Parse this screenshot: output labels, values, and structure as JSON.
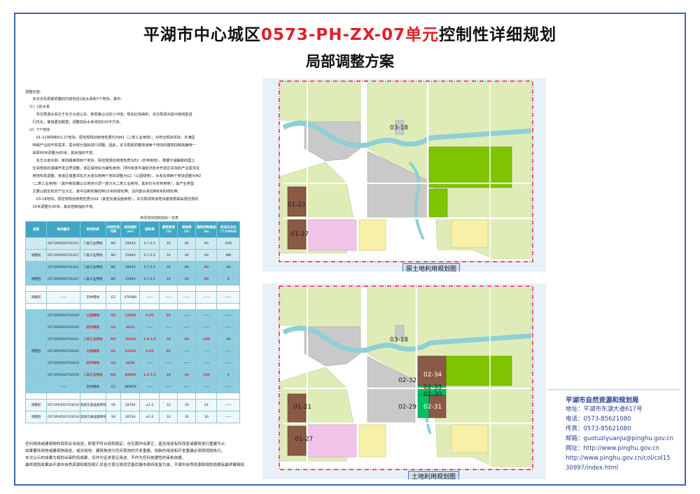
{
  "title": {
    "prefix": "平湖市中心城区",
    "code": "0573-PH-ZX-07单元",
    "suffix": "控制性详细规划"
  },
  "subtitle": "局部调整方案",
  "desc": [
    "调整内容:",
    "　　本次涉及局部调整的内容包括1处水系和7个地块。其中:",
    "　（1）1处水系",
    "　　　本次局调水系位于东方大道以东、新凯路以北的小河流，现状比较曲折，本次局调对其河道线型进",
    "　　行优化，使其更加顺直，调整前后水系增加520平方米。",
    "　（2）7个地块",
    "　　　01-21地块和01-27地块，原控规规划用地性质均为M2（二类工业用地），为符合现状实际，并满足",
    "　　特殊产业的开发需求，需对部分指标进行调整。因此，本次局部调整将该两个地块的建筑控制高度统一",
    "　　由原60米调整为80米，其余指标不变。",
    "　　　东方大道东侧、新凯路南侧四个地块，原控规规划用地性质为E2（农林用地），根据平湖最新的国土",
    "　　空间规划的城镇开发边界调整，该区域地块为弹性用地，同时考虑平湖经济技术开发区实际的产业需求及",
    "　　用地布局调整，将该区域重邻东方大道东侧两个地块调整为G1（公园绿地），水系东侧两个地块调整为M2",
    "　　（二类工业用地）（其中新凯路以北地块只调一部分为二类工业用地，其余仍为农林用地），其产业类型",
    "　　主要以航空机天产业为主，其中沿新凯路控制15米的绿化带，沿内部水系控制8米的绿化带。",
    "　　　03-18地块，原控规规划用地性质为S9（其他交通设施用地），本次局调将该地块建筑限高由原控规的",
    "　　24米调整为30米，其余控制指标不变。"
  ],
  "table_caption": "修改地块控制指标一览表",
  "table_headers": [
    "类型",
    "地块编号",
    "用地性质",
    "用地性质代码",
    "地块面积（m²）",
    "容积率",
    "建筑密度（%）",
    "绿地率（%）",
    "建筑控制高度（m）",
    "机动车泊位（个/100㎡）"
  ],
  "table_rows": [
    {
      "cls": "a",
      "cells": [
        "",
        "0573PHZX0701021",
        "二类工业用地",
        "M2",
        "59244",
        "0.7-2.5",
        "10",
        "60",
        "60",
        "R30"
      ]
    },
    {
      "cls": "a",
      "cells": [
        "调整前",
        "0573PHZX0701027",
        "二类工业用地",
        "M2",
        "25940",
        "0.7-2.5",
        "10",
        "60",
        "60",
        "W8"
      ]
    },
    {
      "cls": "c",
      "cells": [
        "",
        "0573PHZX0701021",
        "二类工业用地",
        "M2",
        "59244",
        "0.7-2.5",
        "10",
        "60",
        "80",
        "38"
      ]
    },
    {
      "cls": "c",
      "cells": [
        "调整后",
        "0573PHZX0701027",
        "二类工业用地",
        "M2",
        "25940",
        "0.7-2.5",
        "10",
        "60",
        "80",
        "8"
      ]
    },
    {
      "cls": "w",
      "cells": [
        "",
        "",
        "",
        "",
        "",
        "",
        "",
        "",
        "",
        ""
      ]
    },
    {
      "cls": "b",
      "cells": [
        "调整前",
        "——",
        "农林用地",
        "E2",
        "476489",
        "——",
        "——",
        "——",
        "——",
        "——"
      ]
    },
    {
      "cls": "w",
      "cells": [
        "",
        "",
        "",
        "",
        "",
        "",
        "",
        "",
        "",
        ""
      ]
    },
    {
      "cls": "c",
      "cells": [
        "",
        "0573PHZX0702029",
        "公园绿地",
        "G1",
        "12800",
        "0.05",
        "65",
        "——",
        "——",
        "——"
      ]
    },
    {
      "cls": "c",
      "cells": [
        "",
        "0573PHZX0702030",
        "防护绿地",
        "G2",
        "6611",
        "——",
        "——",
        "——",
        "——",
        "——"
      ]
    },
    {
      "cls": "c",
      "cells": [
        "",
        "0573PHZX0702031",
        "二类工业用地",
        "M2",
        "78544",
        "1.0-5.5",
        "10",
        "60",
        "100",
        "38"
      ]
    },
    {
      "cls": "c",
      "cells": [
        "调整后",
        "0573PHZX0702032",
        "公园绿地",
        "G1",
        "12853",
        "0.05",
        "65",
        "——",
        "——",
        "——"
      ]
    },
    {
      "cls": "c",
      "cells": [
        "",
        "0573PHZX0702033",
        "防护绿地",
        "G2",
        "6658",
        "——",
        "——",
        "——",
        "——",
        "——"
      ]
    },
    {
      "cls": "c",
      "cells": [
        "",
        "0573PHZX0702034",
        "二类工业用地",
        "M2",
        "69095",
        "1.0-5.5",
        "10",
        "60",
        "100",
        "5"
      ]
    },
    {
      "cls": "c",
      "cells": [
        "",
        "——",
        "农林用地",
        "E2",
        "289878",
        "——",
        "——",
        "——",
        "——",
        "——"
      ]
    },
    {
      "cls": "w",
      "cells": [
        "",
        "",
        "",
        "",
        "",
        "",
        "",
        "",
        "",
        ""
      ]
    },
    {
      "cls": "b",
      "cells": [
        "调整前",
        "0573PHZX0703018",
        "其他交通设施用地",
        "S9",
        "28764",
        "≤1.0",
        "10",
        "35",
        "24",
        "——"
      ]
    },
    {
      "cls": "b",
      "cells": [
        "调整后",
        "0573PHZX0703018",
        "其他交通设施用地",
        "S9",
        "28764",
        "≤1.0",
        "10",
        "35",
        "30",
        "——"
      ]
    }
  ],
  "footer": [
    "任何用地或建筑物的现状合法用途，即使不符合规划规定，也无需作出更正，直至用途有所改变或建筑进行重建为止;",
    "如果要改用地或建筑物用途，或对用地、建筑物进行任何其他的开发重建，则新的用途和开发重建必须按规划执行。",
    "本次公示的成果为规划合审阶段成果，仅作为征求意见用途，不作为任何依据性的审批依据。",
    "最终规划成果由平湖市自然资源和规划局汇总各方意见修改完善后报市政府批复为准，平湖市自然资源和规划局拥有最终解释权"
  ],
  "map_top": {
    "title": "原土地利用规划图",
    "labels": [
      "03-18",
      "01-21",
      "01-27"
    ]
  },
  "map_bottom": {
    "title": "土地利用规划图",
    "labels": [
      "03-18",
      "02-34",
      "02-32",
      "02-33",
      "02-30",
      "02-29",
      "02-31",
      "01-21",
      "01-27"
    ]
  },
  "contact": {
    "org": "平湖市自然资源和规划局",
    "address": "地址：平湖市东湖大道617号",
    "tel": "电话：0573-85621080",
    "fax": "传真：0573-85621080",
    "email": "邮箱：guotuziyuanju@pinghu.gov.cn",
    "web": "网址：http://www.pinghu.gov.cn",
    "url1": "http://www.pinghu.gov.cn/col/col15",
    "url2": "30997/index.html"
  },
  "colors": {
    "title_accent": "#e0202a",
    "frame": "#3a66b8",
    "table_head": "#3fa7c4",
    "industrial": "#8b5a45",
    "park": "#7fc400",
    "farm": "#dfecb8",
    "water": "#8fcfd6",
    "residential": "#f2c3e8",
    "road": "#ffffff",
    "redline": "#e0202a"
  }
}
